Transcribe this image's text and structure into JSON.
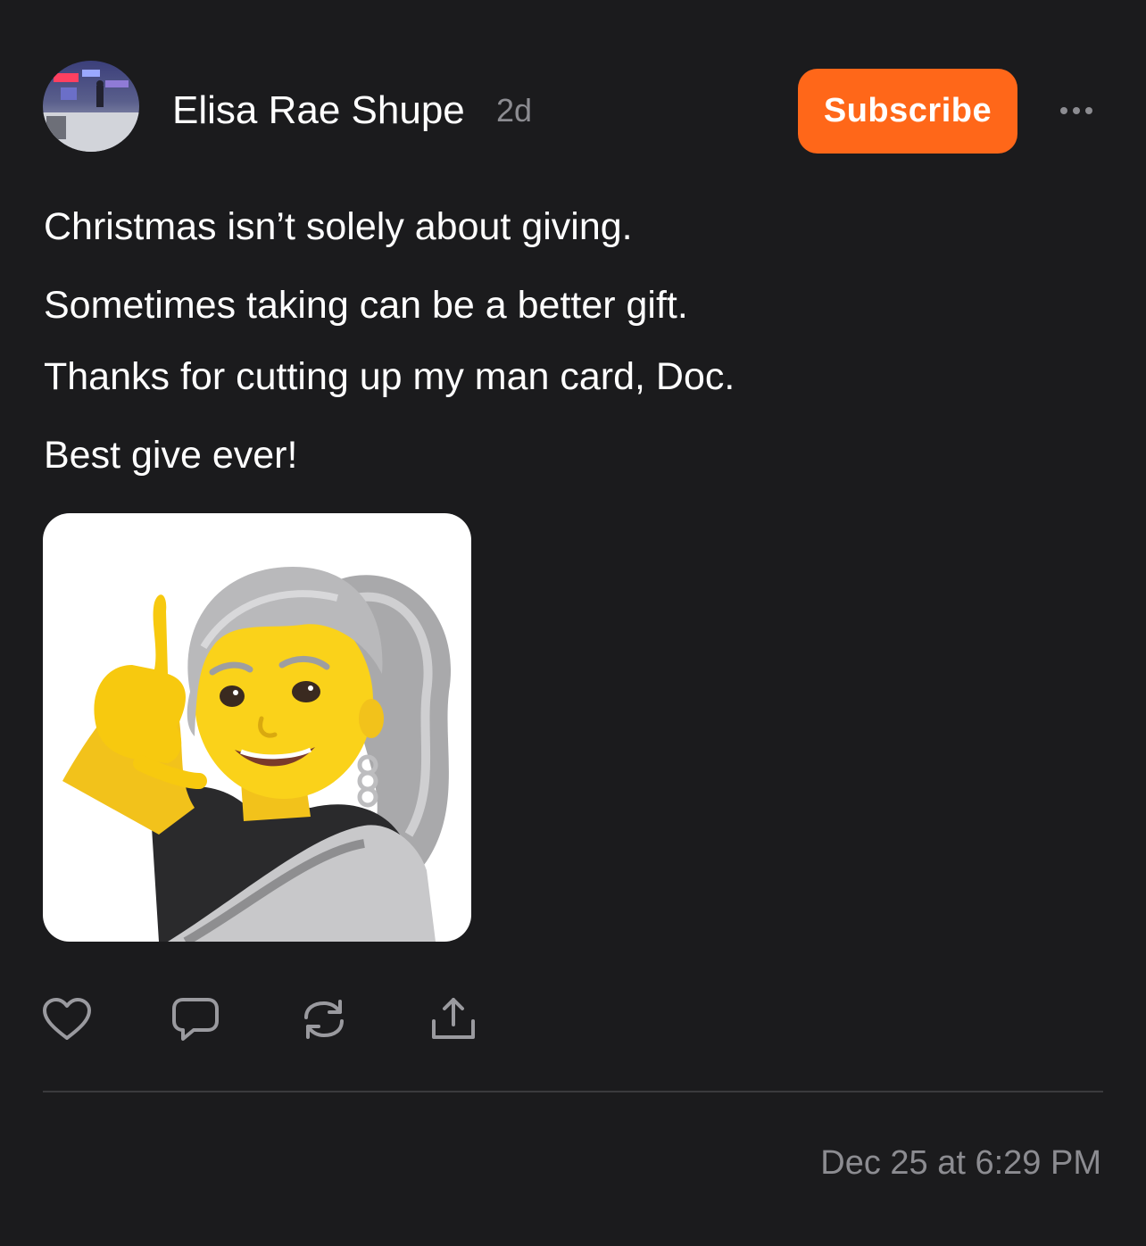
{
  "author": {
    "name": "Elisa Rae Shupe",
    "age": "2d"
  },
  "header": {
    "subscribe_label": "Subscribe",
    "more_icon": "more-horizontal-icon"
  },
  "post": {
    "lines": [
      "Christmas isn’t solely about giving.",
      "Sometimes taking can be a better gift.",
      "Thanks for cutting up my man card, Doc.",
      "Best give ever!"
    ],
    "timestamp": "Dec 25 at 6:29 PM"
  },
  "actions": {
    "icons": [
      "heart-icon",
      "comment-icon",
      "restack-icon",
      "share-icon"
    ]
  },
  "colors": {
    "background": "#1b1b1d",
    "accent": "#ff6719",
    "muted_text": "#8c8c91"
  }
}
